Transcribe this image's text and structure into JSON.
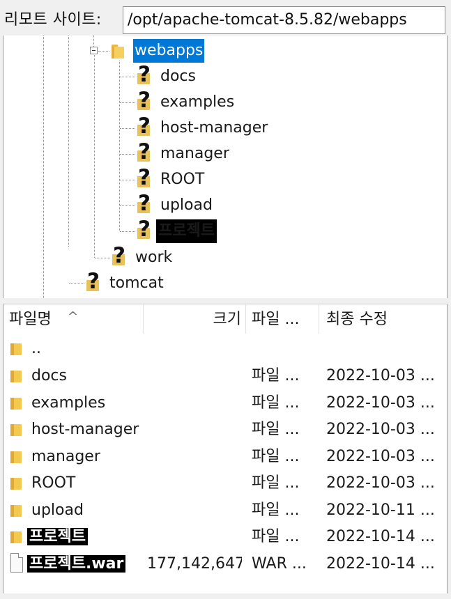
{
  "remote_site": {
    "label": "리모트 사이트:",
    "path": "/opt/apache-tomcat-8.5.82/webapps"
  },
  "tree": {
    "webapps": "webapps",
    "children": [
      "docs",
      "examples",
      "host-manager",
      "manager",
      "ROOT",
      "upload",
      "프로젝트"
    ],
    "work": "work",
    "tomcat": "tomcat",
    "selected": "webapps"
  },
  "file_list": {
    "columns": {
      "name": "파일명",
      "size": "크기",
      "type": "파일 ...",
      "modified": "최종 수정"
    },
    "rows": [
      {
        "name": "..",
        "size": "",
        "type": "",
        "modified": "",
        "icon": "folder-icon"
      },
      {
        "name": "docs",
        "size": "",
        "type": "파일 ...",
        "modified": "2022-10-03 ...",
        "icon": "folder-icon"
      },
      {
        "name": "examples",
        "size": "",
        "type": "파일 ...",
        "modified": "2022-10-03 ...",
        "icon": "folder-icon"
      },
      {
        "name": "host-manager",
        "size": "",
        "type": "파일 ...",
        "modified": "2022-10-03 ...",
        "icon": "folder-icon"
      },
      {
        "name": "manager",
        "size": "",
        "type": "파일 ...",
        "modified": "2022-10-03 ...",
        "icon": "folder-icon"
      },
      {
        "name": "ROOT",
        "size": "",
        "type": "파일 ...",
        "modified": "2022-10-03 ...",
        "icon": "folder-icon"
      },
      {
        "name": "upload",
        "size": "",
        "type": "파일 ...",
        "modified": "2022-10-11 ...",
        "icon": "folder-icon"
      },
      {
        "name": "프로젝트",
        "size": "",
        "type": "파일 ...",
        "modified": "2022-10-14 ...",
        "icon": "folder-icon"
      },
      {
        "name": "프로젝트.war",
        "size": "177,142,647",
        "type": "WAR ...",
        "modified": "2022-10-14 ...",
        "icon": "file-icon"
      }
    ]
  },
  "colors": {
    "selection": "#0078d7",
    "folder": "#f4c94f"
  }
}
